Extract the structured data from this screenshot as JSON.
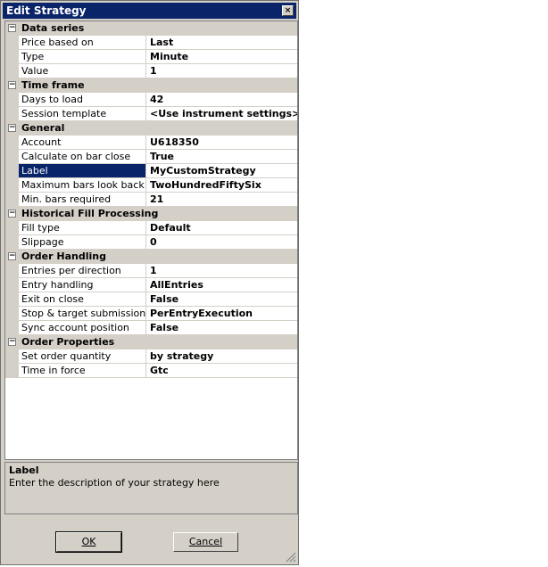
{
  "window": {
    "title": "Edit Strategy",
    "close_symbol": "×"
  },
  "categories": [
    {
      "name": "Data series",
      "expander": "−",
      "props": [
        {
          "name": "Price based on",
          "value": "Last"
        },
        {
          "name": "Type",
          "value": "Minute"
        },
        {
          "name": "Value",
          "value": "1"
        }
      ]
    },
    {
      "name": "Time frame",
      "expander": "−",
      "props": [
        {
          "name": "Days to load",
          "value": "42"
        },
        {
          "name": "Session template",
          "value": "<Use instrument settings>"
        }
      ]
    },
    {
      "name": "General",
      "expander": "−",
      "props": [
        {
          "name": "Account",
          "value": "U618350"
        },
        {
          "name": "Calculate on bar close",
          "value": "True"
        },
        {
          "name": "Label",
          "value": "MyCustomStrategy",
          "selected": true
        },
        {
          "name": "Maximum bars look back",
          "value": "TwoHundredFiftySix"
        },
        {
          "name": "Min. bars required",
          "value": "21"
        }
      ]
    },
    {
      "name": "Historical Fill Processing",
      "expander": "−",
      "props": [
        {
          "name": "Fill type",
          "value": "Default"
        },
        {
          "name": "Slippage",
          "value": "0"
        }
      ]
    },
    {
      "name": "Order Handling",
      "expander": "−",
      "props": [
        {
          "name": "Entries per direction",
          "value": "1"
        },
        {
          "name": "Entry handling",
          "value": "AllEntries"
        },
        {
          "name": "Exit on close",
          "value": "False"
        },
        {
          "name": "Stop & target submission",
          "value": "PerEntryExecution"
        },
        {
          "name": "Sync account position",
          "value": "False"
        }
      ]
    },
    {
      "name": "Order Properties",
      "expander": "−",
      "props": [
        {
          "name": "Set order quantity",
          "value": "by strategy"
        },
        {
          "name": "Time in force",
          "value": "Gtc"
        }
      ]
    }
  ],
  "help": {
    "title": "Label",
    "text": "Enter the description of your strategy here"
  },
  "buttons": {
    "ok_label": "OK",
    "cancel_label": "Cancel"
  },
  "colors": {
    "selection": "#0a246a",
    "face": "#d4d0c8",
    "title_bar": "#0a246a"
  }
}
